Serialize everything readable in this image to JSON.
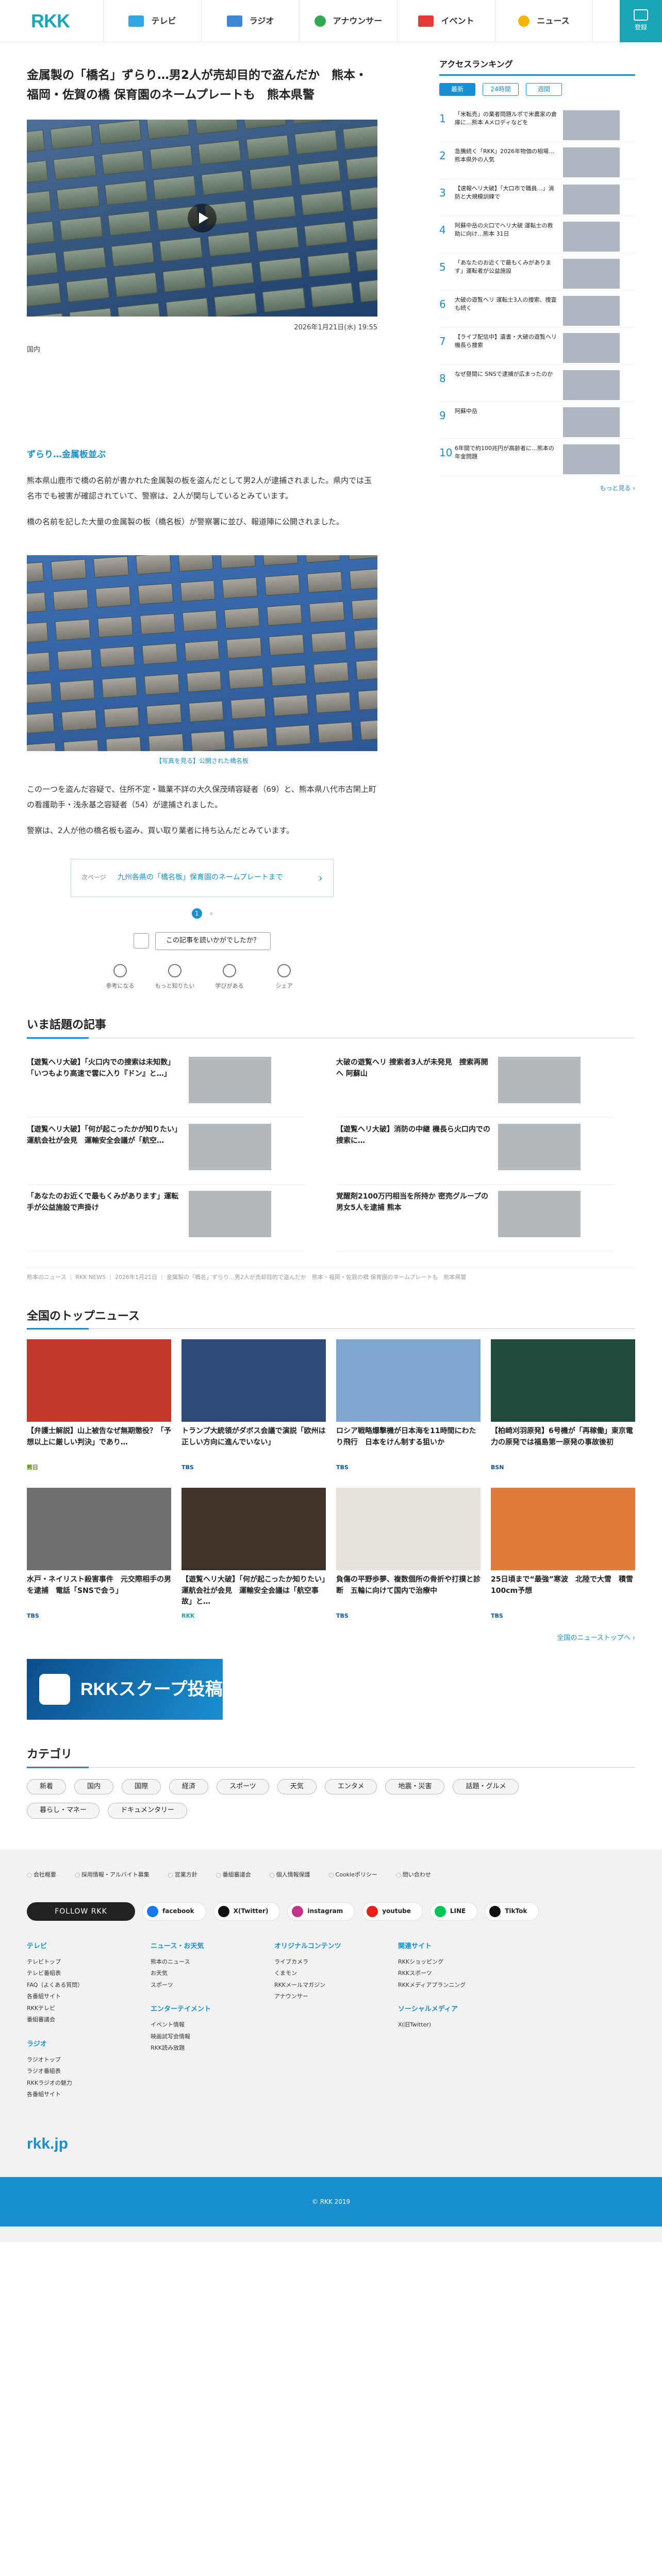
{
  "header": {
    "logo": "RKK",
    "nav": [
      "テレビ",
      "ラジオ",
      "アナウンサー",
      "イベント",
      "ニュース"
    ],
    "login": "登録"
  },
  "article": {
    "title": "金属製の「橋名」ずらり…男2人が売却目的で盗んだか　熊本・福岡・佐賀の橋 保育園のネームプレートも　熊本県警",
    "date": "2026年1月21日(水) 19:55",
    "tag": "国内",
    "lead_head": "ずらり…金属板並ぶ",
    "p1": "熊本県山鹿市で橋の名前が書かれた金属製の板を盗んだとして男2人が逮捕されました。県内では玉名市でも被害が確認されていて、警察は、2人が関与しているとみています。",
    "p2": "橋の名前を記した大量の金属製の板（橋名板）が警察署に並び、報道陣に公開されました。",
    "caption": "【写真を見る】公開された橋名板",
    "p3": "この一つを盗んだ容疑で、住所不定・職業不詳の大久保茂晴容疑者（69）と、熊本県八代市古閑上町の看護助手・浅永基之容疑者（54）が逮捕されました。",
    "p4": "警察は、2人が他の橋名板も盗み、買い取り業者に持ち込んだとみています。",
    "related_label": "次ページ",
    "related_text": "九州各県の「橋名板」保育園のネームプレートまで",
    "page_current": "1",
    "page_next": "›",
    "reaction_q": "この記事を読いかがでしたか？",
    "reactions": [
      "参考になる",
      "もっと知りたい",
      "学びがある",
      "シェア"
    ]
  },
  "sidebar": {
    "heading": "アクセスランキング",
    "tabs": [
      "最新",
      "24時間",
      "週間"
    ],
    "items": [
      {
        "n": "1",
        "t": "「米転売」の業者問題ルポで米農家の倉庫に…熊本 Aメロディなどを"
      },
      {
        "n": "2",
        "t": "急騰続く「RKK」2026年物価の相場…熊本県外の人気"
      },
      {
        "n": "3",
        "t": "【速報ヘリ大破】「大口市で職員…」消防と大規模訓練で"
      },
      {
        "n": "4",
        "t": "阿蘇中岳の火口でヘリ大破 運転士の救助に向け…熊本 31日"
      },
      {
        "n": "5",
        "t": "「あなたのお近くで最もくみがあります」運転者が公益施設"
      },
      {
        "n": "6",
        "t": "大破の遊覧ヘリ 運転士3人の捜索、捜査も続く"
      },
      {
        "n": "7",
        "t": "【ライブ配信中】遺書・大破の遊覧ヘリ機長ら捜索"
      },
      {
        "n": "8",
        "t": "なぜ昼間に SNSで逮捕が広まったのか"
      },
      {
        "n": "9",
        "t": "阿蘇中岳 "
      },
      {
        "n": "10",
        "t": "6年間で約100兆円が高齢者に…熊本の年金問題"
      }
    ],
    "more": "もっと見る ›"
  },
  "wadai": {
    "heading": "いま話題の記事",
    "items": [
      {
        "t": "【遊覧ヘリ大破】「火口内での捜索は未知数」「いつもより高速で雲に入り『ドン』と…」",
        "d": ""
      },
      {
        "t": "大破の遊覧ヘリ 捜索者3人が未発見　捜索再開へ 阿蘇山",
        "d": ""
      },
      {
        "t": "【遊覧ヘリ大破】「何が起こったかが知りたい」運航会社が会見　運輸安全会議が「航空…",
        "d": ""
      },
      {
        "t": "【遊覧ヘリ大破】消防の中継 機長ら火口内での捜索に…",
        "d": ""
      },
      {
        "t": "「あなたのお近くで最もくみがあります」運転手が公益施設で声掛け",
        "d": ""
      },
      {
        "t": "覚醒剤2100万円相当を所持か 密売グループの男女5人を逮捕 熊本",
        "d": ""
      }
    ]
  },
  "breadcrumb": "熊本のニュース ｜ RKK NEWS ｜ 2026年1月21日 ｜ 金属製の「橋名」ずらり…男2人が売却目的で盗んだか　熊本・福岡・佐賀の橋 保育園のネームプレートも　熊本県警",
  "top_news": {
    "heading": "全国のトップニュース",
    "items": [
      {
        "t": "【弁護士解説】山上被告なぜ無期懲役？「予想以上に厳しい判決」であり…",
        "src": "熊日"
      },
      {
        "t": "トランプ大統領がダボス会議で演説「欧州は正しい方向に進んでいない」",
        "src": "TBS"
      },
      {
        "t": "ロシア戦略爆撃機が日本海を11時間にわたり飛行　日本をけん制する狙いか",
        "src": "TBS"
      },
      {
        "t": "【柏崎刈羽原発】6号機が「再稼働」東京電力の原発では福島第一原発の事故後初",
        "src": "BSN"
      },
      {
        "t": "水戸・ネイリスト殺害事件　元交際相手の男を逮捕　電話「SNSで会う」",
        "src": "TBS"
      },
      {
        "t": "【遊覧ヘリ大破】「何が起こったか知りたい」運航会社が会見　運輸安全会議は「航空事故」と…",
        "src": "RKK"
      },
      {
        "t": "負傷の平野歩夢、複数個所の骨折や打撲と診断　五輪に向けて国内で治療中",
        "src": "TBS"
      },
      {
        "t": "25日頃まで“最強”寒波　北陸で大雪　積雪100cm予想",
        "src": "TBS"
      }
    ],
    "more": "全国のニューストップへ ›"
  },
  "scoop": "RKKスクープ投稿",
  "categories": {
    "heading": "カテゴリ",
    "items": [
      "新着",
      "国内",
      "国際",
      "経済",
      "スポーツ",
      "天気",
      "エンタメ",
      "地震・災害",
      "話題・グルメ",
      "暮らし・マネー",
      "ドキュメンタリー"
    ]
  },
  "footer": {
    "nav": [
      "会社概要",
      "採用情報・アルバイト募集",
      "営業方針",
      "番組審議会",
      "個人情報保護",
      "Cookieポリシー",
      "問い合わせ"
    ],
    "follow": "FOLLOW RKK",
    "sns": [
      {
        "name": "facebook",
        "color": "#1877f2"
      },
      {
        "name": "X(Twitter)",
        "color": "#111111"
      },
      {
        "name": "instagram",
        "color": "#c13584"
      },
      {
        "name": "youtube",
        "color": "#e62117"
      },
      {
        "name": "LINE",
        "color": "#06c755"
      },
      {
        "name": "TikTok",
        "color": "#111111"
      }
    ],
    "cols": [
      {
        "h": "テレビ",
        "li": [
          "テレビトップ",
          "テレビ番組表",
          "FAQ（よくある質問）",
          "各番組サイト",
          "RKKテレビ",
          "番組審議会"
        ],
        "h2": "ラジオ",
        "li2": [
          "ラジオトップ",
          "ラジオ番組表",
          "RKKラジオの魅力",
          "各番組サイト"
        ]
      },
      {
        "h": "ニュース・お天気",
        "li": [
          "熊本のニュース",
          "お天気",
          "スポーツ"
        ],
        "h2": "エンターテイメント",
        "li2": [
          "イベント情報",
          "映画試写会情報",
          "RKK読み放題"
        ]
      },
      {
        "h": "オリジナルコンテンツ",
        "li": [
          "ライブカメラ",
          "くまモン",
          "RKKメールマガジン",
          "アナウンサー"
        ],
        "h2": "",
        "li2": []
      },
      {
        "h": "関連サイト",
        "li": [
          "RKKショッピング",
          "RKKスポーツ",
          "RKKメディアプランニング"
        ],
        "h2": "ソーシャルメディア",
        "li2": [
          "X(旧Twitter)"
        ]
      }
    ],
    "logo": "rkk.jp",
    "copyright": "© RKK 2019"
  }
}
